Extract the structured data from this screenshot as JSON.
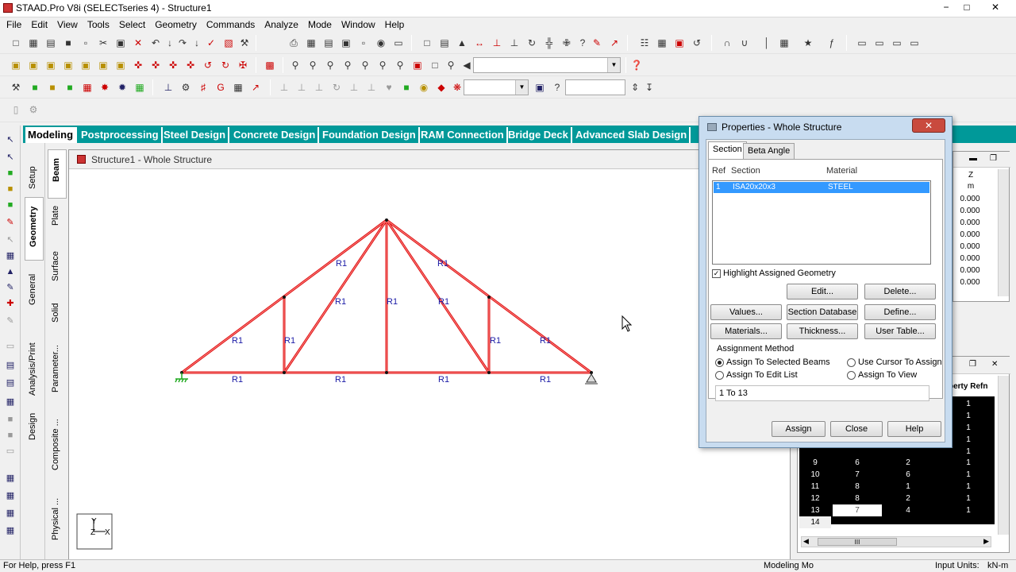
{
  "window": {
    "title": "STAAD.Pro V8i (SELECTseries 4) - Structure1",
    "min_label": "−",
    "max_label": "□",
    "close_label": "✕"
  },
  "menu": [
    "File",
    "Edit",
    "View",
    "Tools",
    "Select",
    "Geometry",
    "Commands",
    "Analyze",
    "Mode",
    "Window",
    "Help"
  ],
  "toolbar": {
    "help_glyph": "?",
    "search_placeholder": ""
  },
  "page_tabs": [
    "Modeling",
    "Postprocessing",
    "Steel Design",
    "Concrete Design",
    "Foundation Design",
    "RAM Connection",
    "Bridge Deck",
    "Advanced Slab Design"
  ],
  "vertical_tabs_left": [
    "Setup",
    "Geometry",
    "General",
    "Analysis/Print",
    "Design"
  ],
  "vertical_tabs_right": [
    "Beam",
    "Plate",
    "Surface",
    "Solid",
    "Parameter...",
    "Composite ...",
    "Physical ..."
  ],
  "structure_window": {
    "title": "Structure1 - Whole Structure",
    "member_label": "R1",
    "axis_x": "X",
    "axis_y": "Y",
    "axis_z": "Z"
  },
  "dialog": {
    "title": "Properties - Whole Structure",
    "close": "✕",
    "tabs": [
      "Section",
      "Beta Angle"
    ],
    "headers": {
      "ref": "Ref",
      "section": "Section",
      "material": "Material"
    },
    "rows": [
      {
        "ref": "1",
        "section": "ISA20x20x3",
        "material": "STEEL"
      }
    ],
    "highlight_label": "Highlight Assigned Geometry",
    "highlight_checked": true,
    "buttons": {
      "edit": "Edit...",
      "delete": "Delete...",
      "values": "Values...",
      "section_database": "Section Database",
      "define": "Define...",
      "materials": "Materials...",
      "thickness": "Thickness...",
      "user_table": "User Table..."
    },
    "assignment_method": {
      "title": "Assignment Method",
      "options": [
        "Assign To Selected Beams",
        "Use Cursor To Assign",
        "Assign To Edit List",
        "Assign To View"
      ],
      "selected": "Assign To Selected Beams",
      "edit_list": "1 To 13"
    },
    "footer": {
      "assign": "Assign",
      "close": "Close",
      "help": "Help"
    }
  },
  "right_window_1": {
    "header_z": "Z",
    "header_unit": "m",
    "values": [
      "0.000",
      "0.000",
      "0.000",
      "0.000",
      "0.000",
      "0.000",
      "0.000",
      "0.000"
    ]
  },
  "right_window_2": {
    "header": "perty Refn",
    "rows": [
      {
        "n": "",
        "a": "",
        "b": "",
        "c": "1"
      },
      {
        "n": "",
        "a": "",
        "b": "",
        "c": "1"
      },
      {
        "n": "",
        "a": "",
        "b": "",
        "c": "1"
      },
      {
        "n": "",
        "a": "",
        "b": "",
        "c": "1"
      },
      {
        "n": "",
        "a": "",
        "b": "",
        "c": "1"
      },
      {
        "n": "9",
        "a": "6",
        "b": "2",
        "c": "1"
      },
      {
        "n": "10",
        "a": "7",
        "b": "6",
        "c": "1"
      },
      {
        "n": "11",
        "a": "8",
        "b": "1",
        "c": "1"
      },
      {
        "n": "12",
        "a": "8",
        "b": "2",
        "c": "1"
      },
      {
        "n": "13",
        "a": "7",
        "b": "4",
        "c": "1"
      },
      {
        "n": "14",
        "a": "",
        "b": "",
        "c": ""
      }
    ],
    "scroll_glyph": "III"
  },
  "status": {
    "help": "For Help, press F1",
    "mode": "Modeling Mo",
    "units_label": "Input Units:",
    "units_value": "kN-m"
  },
  "colors": {
    "tab_bar": "#009999",
    "member": "#dd1111",
    "label": "#1a1aa6",
    "selection": "#3399ff"
  }
}
